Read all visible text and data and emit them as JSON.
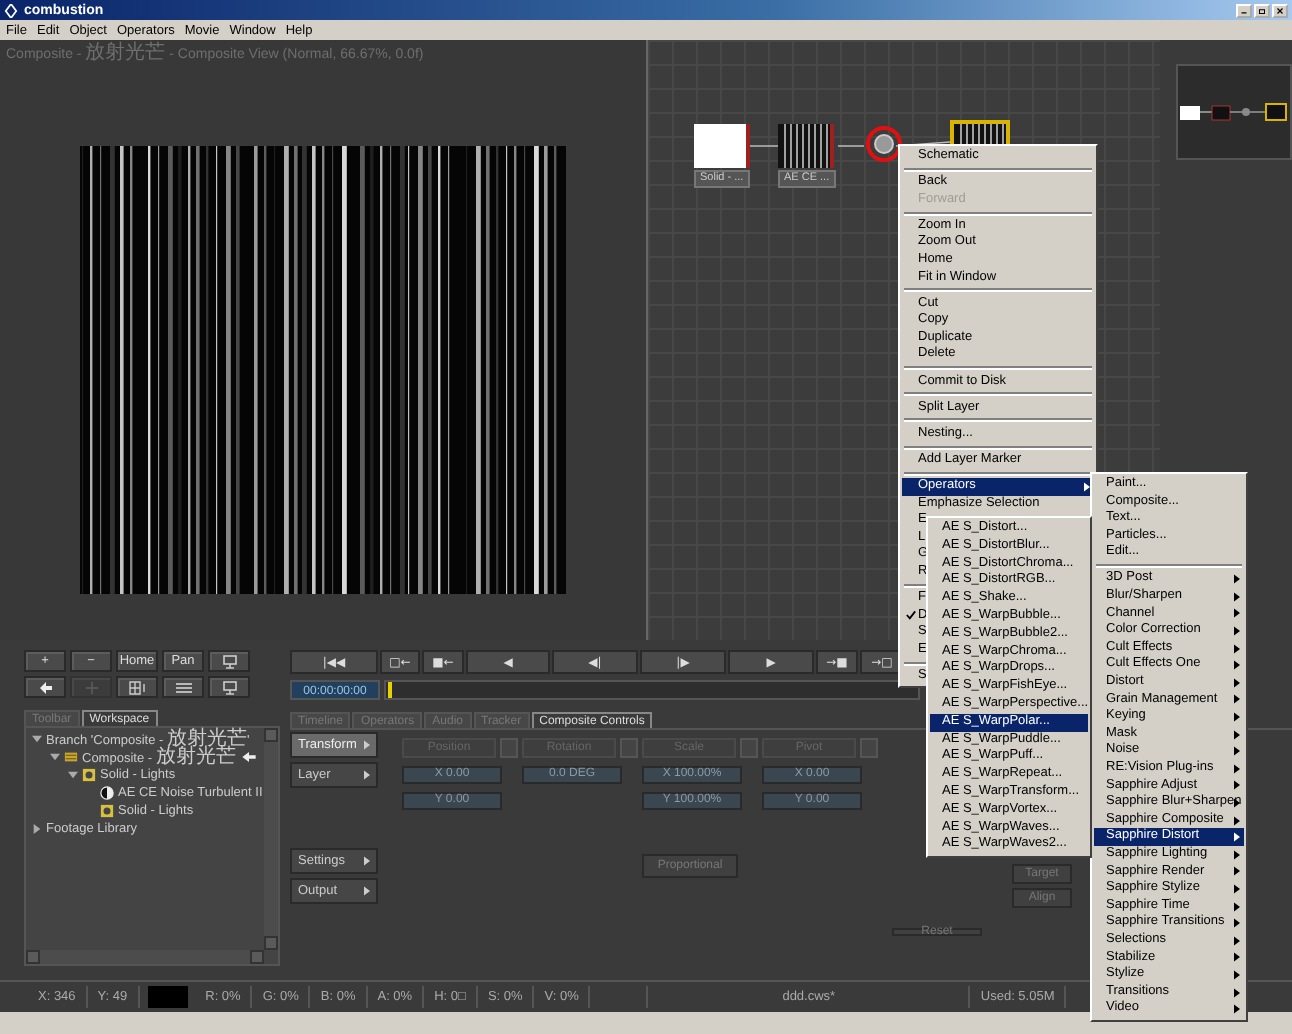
{
  "window": {
    "title": "combustion"
  },
  "menu_bar": [
    "File",
    "Edit",
    "Object",
    "Operators",
    "Movie",
    "Window",
    "Help"
  ],
  "viewer": {
    "title": "Composite - 放射光芒 - Composite View (Normal, 66.67%, 0.0f)"
  },
  "schematic": {
    "nodes": [
      {
        "kind": "solid",
        "label": "Solid - ...",
        "selected": false,
        "highlighted": false
      },
      {
        "kind": "effect",
        "label": "AE CE ...",
        "selected": false,
        "highlighted": false
      },
      {
        "kind": "point",
        "selected": false,
        "highlighted": true
      },
      {
        "kind": "output",
        "selected": true,
        "highlighted": false
      }
    ]
  },
  "context_menu": {
    "items": [
      {
        "kind": "item",
        "label": "Schematic",
        "selected": false,
        "disabled": false,
        "checked": false,
        "submenu": false
      },
      {
        "kind": "separator"
      },
      {
        "kind": "item",
        "label": "Back",
        "selected": false,
        "disabled": false,
        "checked": false,
        "submenu": false
      },
      {
        "kind": "item",
        "label": "Forward",
        "selected": false,
        "disabled": true,
        "checked": false,
        "submenu": false
      },
      {
        "kind": "separator"
      },
      {
        "kind": "item",
        "label": "Zoom In",
        "selected": false,
        "disabled": false,
        "checked": false,
        "submenu": false
      },
      {
        "kind": "item",
        "label": "Zoom Out",
        "selected": false,
        "disabled": false,
        "checked": false,
        "submenu": false
      },
      {
        "kind": "item",
        "label": "Home",
        "selected": false,
        "disabled": false,
        "checked": false,
        "submenu": false
      },
      {
        "kind": "item",
        "label": "Fit in Window",
        "selected": false,
        "disabled": false,
        "checked": false,
        "submenu": false
      },
      {
        "kind": "separator"
      },
      {
        "kind": "item",
        "label": "Cut",
        "selected": false,
        "disabled": false,
        "checked": false,
        "submenu": false
      },
      {
        "kind": "item",
        "label": "Copy",
        "selected": false,
        "disabled": false,
        "checked": false,
        "submenu": false
      },
      {
        "kind": "item",
        "label": "Duplicate",
        "selected": false,
        "disabled": false,
        "checked": false,
        "submenu": false
      },
      {
        "kind": "item",
        "label": "Delete",
        "selected": false,
        "disabled": false,
        "checked": false,
        "submenu": false
      },
      {
        "kind": "separator"
      },
      {
        "kind": "item",
        "label": "Commit to Disk",
        "selected": false,
        "disabled": false,
        "checked": false,
        "submenu": false
      },
      {
        "kind": "separator"
      },
      {
        "kind": "item",
        "label": "Split Layer",
        "selected": false,
        "disabled": false,
        "checked": false,
        "submenu": false
      },
      {
        "kind": "separator"
      },
      {
        "kind": "item",
        "label": "Nesting...",
        "selected": false,
        "disabled": false,
        "checked": false,
        "submenu": false
      },
      {
        "kind": "separator"
      },
      {
        "kind": "item",
        "label": "Add Layer Marker",
        "selected": false,
        "disabled": false,
        "checked": false,
        "submenu": false
      },
      {
        "kind": "separator"
      },
      {
        "kind": "item",
        "label": "Operators",
        "selected": true,
        "disabled": false,
        "checked": false,
        "submenu": true
      },
      {
        "kind": "item",
        "label": "Emphasize Selection",
        "selected": false,
        "disabled": false,
        "checked": false,
        "submenu": false
      },
      {
        "kind": "item",
        "label": "E",
        "selected": false,
        "disabled": false,
        "checked": false,
        "submenu": false
      },
      {
        "kind": "item",
        "label": "L",
        "selected": false,
        "disabled": false,
        "checked": false,
        "submenu": false
      },
      {
        "kind": "item",
        "label": "G",
        "selected": false,
        "disabled": false,
        "checked": false,
        "submenu": false
      },
      {
        "kind": "item",
        "label": "R",
        "selected": false,
        "disabled": false,
        "checked": false,
        "submenu": false
      },
      {
        "kind": "separator"
      },
      {
        "kind": "item",
        "label": "F",
        "selected": false,
        "disabled": false,
        "checked": false,
        "submenu": false
      },
      {
        "kind": "item",
        "label": "D",
        "selected": false,
        "disabled": false,
        "checked": true,
        "submenu": false
      },
      {
        "kind": "item",
        "label": "S",
        "selected": false,
        "disabled": false,
        "checked": false,
        "submenu": false
      },
      {
        "kind": "item",
        "label": "E",
        "selected": false,
        "disabled": false,
        "checked": false,
        "submenu": false
      },
      {
        "kind": "separator"
      },
      {
        "kind": "item",
        "label": "S",
        "selected": false,
        "disabled": false,
        "checked": false,
        "submenu": false
      }
    ]
  },
  "operators_submenu": {
    "items": [
      {
        "kind": "item",
        "label": "Paint...",
        "selected": false,
        "submenu": false
      },
      {
        "kind": "item",
        "label": "Composite...",
        "selected": false,
        "submenu": false
      },
      {
        "kind": "item",
        "label": "Text...",
        "selected": false,
        "submenu": false
      },
      {
        "kind": "item",
        "label": "Particles...",
        "selected": false,
        "submenu": false
      },
      {
        "kind": "item",
        "label": "Edit...",
        "selected": false,
        "submenu": false
      },
      {
        "kind": "separator"
      },
      {
        "kind": "item",
        "label": "3D Post",
        "selected": false,
        "submenu": true
      },
      {
        "kind": "item",
        "label": "Blur/Sharpen",
        "selected": false,
        "submenu": true
      },
      {
        "kind": "item",
        "label": "Channel",
        "selected": false,
        "submenu": true
      },
      {
        "kind": "item",
        "label": "Color Correction",
        "selected": false,
        "submenu": true
      },
      {
        "kind": "item",
        "label": "Cult Effects",
        "selected": false,
        "submenu": true
      },
      {
        "kind": "item",
        "label": "Cult Effects One",
        "selected": false,
        "submenu": true
      },
      {
        "kind": "item",
        "label": "Distort",
        "selected": false,
        "submenu": true
      },
      {
        "kind": "item",
        "label": "Grain Management",
        "selected": false,
        "submenu": true
      },
      {
        "kind": "item",
        "label": "Keying",
        "selected": false,
        "submenu": true
      },
      {
        "kind": "item",
        "label": "Mask",
        "selected": false,
        "submenu": true
      },
      {
        "kind": "item",
        "label": "Noise",
        "selected": false,
        "submenu": true
      },
      {
        "kind": "item",
        "label": "RE:Vision Plug-ins",
        "selected": false,
        "submenu": true
      },
      {
        "kind": "item",
        "label": "Sapphire Adjust",
        "selected": false,
        "submenu": true
      },
      {
        "kind": "item",
        "label": "Sapphire Blur+Sharpen",
        "selected": false,
        "submenu": true
      },
      {
        "kind": "item",
        "label": "Sapphire Composite",
        "selected": false,
        "submenu": true
      },
      {
        "kind": "item",
        "label": "Sapphire Distort",
        "selected": true,
        "submenu": true
      },
      {
        "kind": "item",
        "label": "Sapphire Lighting",
        "selected": false,
        "submenu": true
      },
      {
        "kind": "item",
        "label": "Sapphire Render",
        "selected": false,
        "submenu": true
      },
      {
        "kind": "item",
        "label": "Sapphire Stylize",
        "selected": false,
        "submenu": true
      },
      {
        "kind": "item",
        "label": "Sapphire Time",
        "selected": false,
        "submenu": true
      },
      {
        "kind": "item",
        "label": "Sapphire Transitions",
        "selected": false,
        "submenu": true
      },
      {
        "kind": "item",
        "label": "Selections",
        "selected": false,
        "submenu": true
      },
      {
        "kind": "item",
        "label": "Stabilize",
        "selected": false,
        "submenu": true
      },
      {
        "kind": "item",
        "label": "Stylize",
        "selected": false,
        "submenu": true
      },
      {
        "kind": "item",
        "label": "Transitions",
        "selected": false,
        "submenu": true
      },
      {
        "kind": "item",
        "label": "Video",
        "selected": false,
        "submenu": true
      }
    ]
  },
  "distort_submenu": {
    "items": [
      {
        "label": "AE S_Distort...",
        "selected": false
      },
      {
        "label": "AE S_DistortBlur...",
        "selected": false
      },
      {
        "label": "AE S_DistortChroma...",
        "selected": false
      },
      {
        "label": "AE S_DistortRGB...",
        "selected": false
      },
      {
        "label": "AE S_Shake...",
        "selected": false
      },
      {
        "label": "AE S_WarpBubble...",
        "selected": false
      },
      {
        "label": "AE S_WarpBubble2...",
        "selected": false
      },
      {
        "label": "AE S_WarpChroma...",
        "selected": false
      },
      {
        "label": "AE S_WarpDrops...",
        "selected": false
      },
      {
        "label": "AE S_WarpFishEye...",
        "selected": false
      },
      {
        "label": "AE S_WarpPerspective...",
        "selected": false
      },
      {
        "label": "AE S_WarpPolar...",
        "selected": true
      },
      {
        "label": "AE S_WarpPuddle...",
        "selected": false
      },
      {
        "label": "AE S_WarpPuff...",
        "selected": false
      },
      {
        "label": "AE S_WarpRepeat...",
        "selected": false
      },
      {
        "label": "AE S_WarpTransform...",
        "selected": false
      },
      {
        "label": "AE S_WarpVortex...",
        "selected": false
      },
      {
        "label": "AE S_WarpWaves...",
        "selected": false
      },
      {
        "label": "AE S_WarpWaves2...",
        "selected": false
      }
    ]
  },
  "view_buttons": [
    {
      "kind": "text",
      "label": "+",
      "disabled": false
    },
    {
      "kind": "text",
      "label": "−",
      "disabled": false
    },
    {
      "kind": "text",
      "label": "Home",
      "disabled": false
    },
    {
      "kind": "text",
      "label": "Pan",
      "disabled": false
    },
    {
      "kind": "monitor",
      "disabled": false
    },
    {
      "kind": "arrow",
      "disabled": false
    },
    {
      "kind": "hand",
      "disabled": true
    },
    {
      "kind": "grid",
      "disabled": false
    },
    {
      "kind": "layout",
      "disabled": false
    },
    {
      "kind": "monitor",
      "disabled": false
    }
  ],
  "transport": {
    "buttons": [
      "|◀◀",
      "□←",
      "■←",
      "◀",
      "◀|",
      "|▶",
      "▶",
      "→■",
      "→□"
    ],
    "timecode": "00:00:00:00"
  },
  "workspace": {
    "tabs": [
      {
        "label": "Toolbar",
        "selected": false
      },
      {
        "label": "Workspace",
        "selected": true
      }
    ],
    "tree": [
      {
        "label": "Branch 'Composite - 放射光芒'",
        "expanded": true,
        "current": false,
        "children": [
          {
            "label": "Composite - 放射光芒",
            "kind": "composite",
            "expanded": true,
            "current": true,
            "children": [
              {
                "label": "Solid - Lights",
                "kind": "solid",
                "expanded": true,
                "current": false,
                "children": [
                  {
                    "label": "AE CE Noise Turbulent II",
                    "kind": "effect",
                    "current": false
                  },
                  {
                    "label": "Solid - Lights",
                    "kind": "solid",
                    "current": false
                  }
                ]
              }
            ]
          }
        ]
      },
      {
        "label": "Footage Library",
        "expanded": false,
        "current": false
      }
    ]
  },
  "controls": {
    "tabs": [
      {
        "label": "Timeline",
        "selected": false
      },
      {
        "label": "Operators",
        "selected": false
      },
      {
        "label": "Audio",
        "selected": false
      },
      {
        "label": "Tracker",
        "selected": false
      },
      {
        "label": "Composite Controls",
        "selected": true
      }
    ],
    "sections": [
      {
        "label": "Transform",
        "selected": true
      },
      {
        "label": "Layer",
        "selected": false
      },
      {
        "label": "Settings",
        "selected": false
      },
      {
        "label": "Output",
        "selected": false
      }
    ],
    "columns": [
      {
        "label": "Position",
        "fields": [
          "X 0.00",
          "Y 0.00"
        ]
      },
      {
        "label": "Rotation",
        "fields": [
          "0.0 DEG"
        ]
      },
      {
        "label": "Scale",
        "fields": [
          "X 100.00%",
          "Y 100.00%"
        ]
      },
      {
        "label": "Pivot",
        "fields": [
          "X 0.00",
          "Y 0.00"
        ]
      }
    ],
    "proportional": "Proportional",
    "reset": "Reset",
    "target": "Target",
    "align": "Align"
  },
  "status_bar": [
    {
      "kind": "text",
      "label": "X: 346"
    },
    {
      "kind": "text",
      "label": "Y: 49"
    },
    {
      "kind": "swatch"
    },
    {
      "kind": "text",
      "label": "R: 0%"
    },
    {
      "kind": "text",
      "label": "G: 0%"
    },
    {
      "kind": "text",
      "label": "B: 0%"
    },
    {
      "kind": "text",
      "label": "A: 0%"
    },
    {
      "kind": "text",
      "label": "H: 0□"
    },
    {
      "kind": "text",
      "label": "S: 0%"
    },
    {
      "kind": "text",
      "label": "V: 0%"
    },
    {
      "kind": "file",
      "label": "ddd.cws*"
    },
    {
      "kind": "text",
      "label": "Used: 5.05M"
    }
  ]
}
